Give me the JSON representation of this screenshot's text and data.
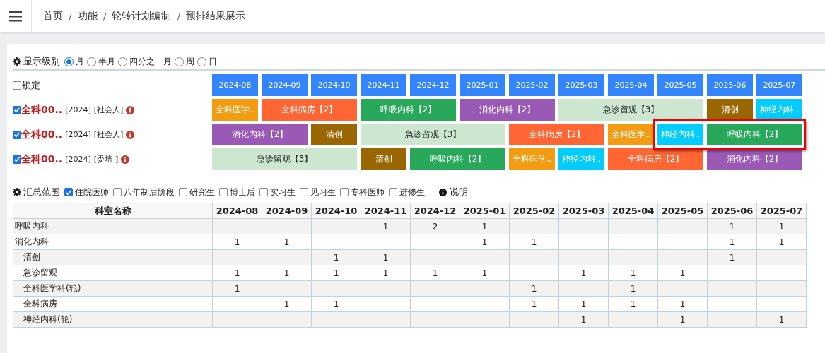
{
  "breadcrumb": {
    "separator": "/",
    "items": [
      "首页",
      "功能",
      "轮转计划编制",
      "预排结果展示"
    ]
  },
  "display_level": {
    "label": "显示级别",
    "options": [
      {
        "label": "月",
        "selected": true
      },
      {
        "label": "半月",
        "selected": false
      },
      {
        "label": "四分之一月",
        "selected": false
      },
      {
        "label": "周",
        "selected": false
      },
      {
        "label": "日",
        "selected": false
      }
    ]
  },
  "lock": {
    "label": "锁定",
    "checked": false
  },
  "months": [
    "2024-08",
    "2024-09",
    "2024-10",
    "2024-11",
    "2024-12",
    "2025-01",
    "2025-02",
    "2025-03",
    "2025-04",
    "2025-05",
    "2025-06",
    "2025-07"
  ],
  "students": [
    {
      "name": "全科00..",
      "year": "[2024]",
      "type": "[社会人]",
      "checked": true,
      "slots": [
        {
          "kind": "block",
          "label": "全科医学..",
          "color": "#f39c12",
          "highlighted": false
        },
        {
          "kind": "block",
          "label": "全科病房【2】",
          "color": "#ff6633",
          "highlighted": false
        },
        {
          "kind": "continued"
        },
        {
          "kind": "block",
          "label": "呼吸内科【2】",
          "color": "#27a85a",
          "highlighted": false
        },
        {
          "kind": "continued"
        },
        {
          "kind": "block",
          "label": "消化内科【2】",
          "color": "#9b59b6",
          "highlighted": false
        },
        {
          "kind": "continued"
        },
        {
          "kind": "block",
          "label": "急诊留观【3】",
          "color": "#cce6cf",
          "highlighted": false
        },
        {
          "kind": "continued"
        },
        {
          "kind": "continued"
        },
        {
          "kind": "block",
          "label": "清创",
          "color": "#996600",
          "highlighted": false
        },
        {
          "kind": "block",
          "label": "神经内科..",
          "color": "#00ccff",
          "highlighted": false
        }
      ]
    },
    {
      "name": "全科00..",
      "year": "[2024]",
      "type": "[社会人]",
      "checked": true,
      "slots": [
        {
          "kind": "block",
          "label": "消化内科【2】",
          "color": "#9b59b6",
          "highlighted": false
        },
        {
          "kind": "continued"
        },
        {
          "kind": "block",
          "label": "清创",
          "color": "#996600",
          "highlighted": false
        },
        {
          "kind": "block",
          "label": "急诊留观【3】",
          "color": "#cce6cf",
          "highlighted": false
        },
        {
          "kind": "continued"
        },
        {
          "kind": "continued"
        },
        {
          "kind": "block",
          "label": "全科病房【2】",
          "color": "#ff6633",
          "highlighted": false
        },
        {
          "kind": "continued"
        },
        {
          "kind": "block",
          "label": "全科医学..",
          "color": "#f39c12",
          "highlighted": false
        },
        {
          "kind": "block",
          "label": "神经内科..",
          "color": "#00ccff",
          "highlighted": true
        },
        {
          "kind": "block",
          "label": "呼吸内科【2】",
          "color": "#27a85a",
          "highlighted": true
        },
        {
          "kind": "continued"
        }
      ]
    },
    {
      "name": "全科00..",
      "year": "[2024]",
      "type": "[委培-]",
      "checked": true,
      "slots": [
        {
          "kind": "block",
          "label": "急诊留观【3】",
          "color": "#cce6cf",
          "highlighted": false
        },
        {
          "kind": "continued"
        },
        {
          "kind": "continued"
        },
        {
          "kind": "block",
          "label": "清创",
          "color": "#996600",
          "highlighted": false
        },
        {
          "kind": "block",
          "label": "呼吸内科【2】",
          "color": "#27a85a",
          "highlighted": false
        },
        {
          "kind": "continued"
        },
        {
          "kind": "block",
          "label": "全科医学..",
          "color": "#f39c12",
          "highlighted": false
        },
        {
          "kind": "block",
          "label": "神经内科..",
          "color": "#00ccff",
          "highlighted": false
        },
        {
          "kind": "block",
          "label": "全科病房【2】",
          "color": "#ff6633",
          "highlighted": false
        },
        {
          "kind": "continued"
        },
        {
          "kind": "block",
          "label": "消化内科【2】",
          "color": "#9b59b6",
          "highlighted": false
        },
        {
          "kind": "continued"
        }
      ]
    }
  ],
  "summary_scope": {
    "label": "汇总范围",
    "options": [
      {
        "label": "住院医师",
        "checked": true
      },
      {
        "label": "八年制后阶段",
        "checked": false
      },
      {
        "label": "研究生",
        "checked": false
      },
      {
        "label": "博士后",
        "checked": false
      },
      {
        "label": "实习生",
        "checked": false
      },
      {
        "label": "见习生",
        "checked": false
      },
      {
        "label": "专科医师",
        "checked": false
      },
      {
        "label": "进修生",
        "checked": false
      }
    ],
    "help": "说明"
  },
  "table": {
    "columns": [
      "科室名称",
      "2024-08",
      "2024-09",
      "2024-10",
      "2024-11",
      "2024-12",
      "2025-01",
      "2025-02",
      "2025-03",
      "2025-04",
      "2025-05",
      "2025-06",
      "2025-07"
    ],
    "rows": [
      {
        "cells": [
          "呼吸内科",
          "",
          "",
          "",
          "1",
          "2",
          "1",
          "",
          "",
          "",
          "",
          "1",
          "1"
        ]
      },
      {
        "cells": [
          "消化内科",
          "1",
          "1",
          "",
          "",
          "",
          "1",
          "1",
          "",
          "",
          "",
          "1",
          "1"
        ],
        "children": [
          {
            "cells": [
              "清创",
              "",
              "",
              "1",
              "1",
              "",
              "",
              "",
              "",
              "",
              "",
              "1",
              ""
            ]
          },
          {
            "cells": [
              "急诊留观",
              "1",
              "1",
              "1",
              "1",
              "1",
              "1",
              "",
              "1",
              "1",
              "1",
              "",
              ""
            ]
          },
          {
            "cells": [
              "全科医学科(轮)",
              "1",
              "",
              "",
              "",
              "",
              "",
              "1",
              "",
              "1",
              "",
              "",
              ""
            ]
          },
          {
            "cells": [
              "全科病房",
              "",
              "1",
              "1",
              "",
              "",
              "",
              "1",
              "1",
              "1",
              "1",
              "",
              ""
            ]
          },
          {
            "cells": [
              "神经内科(轮)",
              "",
              "",
              "",
              "",
              "",
              "",
              "",
              "1",
              "",
              "1",
              "",
              "1"
            ]
          }
        ]
      }
    ]
  }
}
